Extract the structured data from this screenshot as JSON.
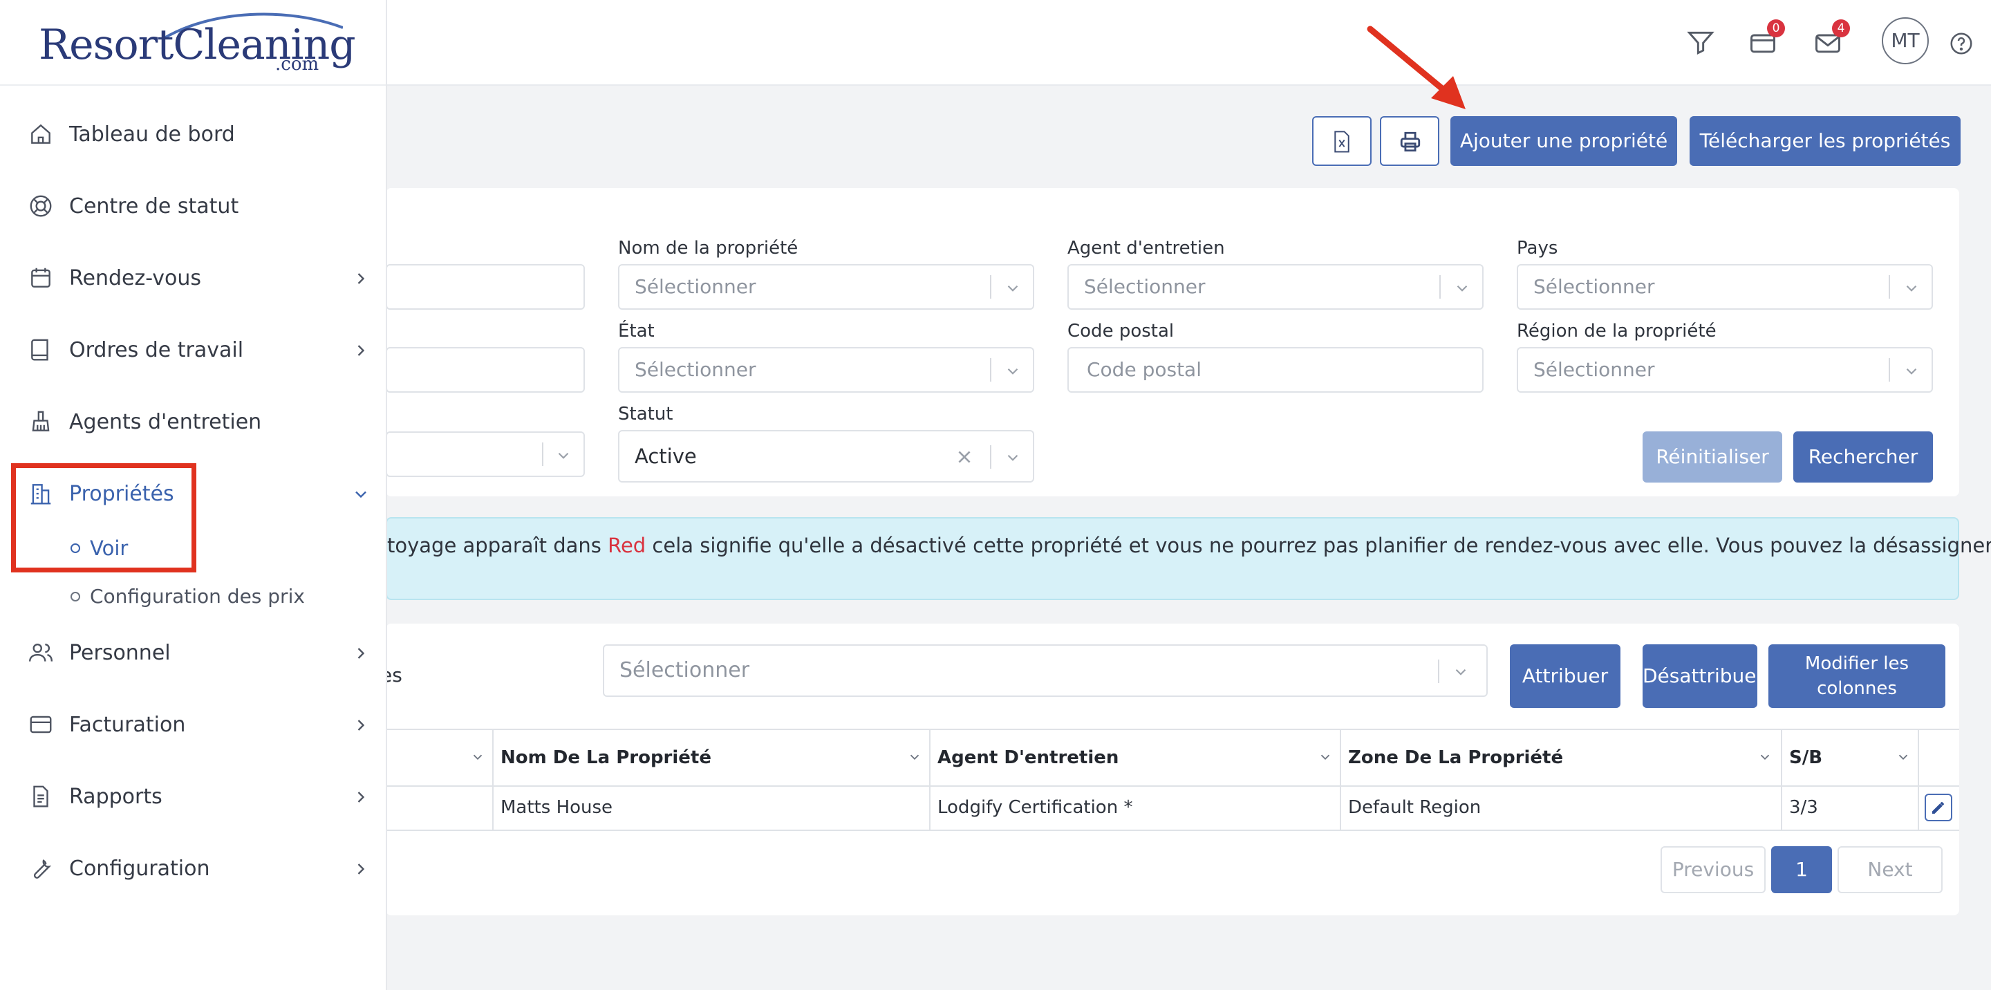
{
  "brand": {
    "logo_main": "ResortCleaning",
    "logo_sub": ".com"
  },
  "header": {
    "cart_badge": "0",
    "mail_badge": "4",
    "avatar_initials": "MT"
  },
  "sidebar": {
    "items": [
      {
        "label": "Tableau de bord",
        "icon": "home-icon"
      },
      {
        "label": "Centre de statut",
        "icon": "lifebuoy-icon"
      },
      {
        "label": "Rendez-vous",
        "icon": "calendar-icon"
      },
      {
        "label": "Ordres de travail",
        "icon": "book-icon"
      },
      {
        "label": "Agents d'entretien",
        "icon": "broom-icon"
      },
      {
        "label": "Propriétés",
        "icon": "building-icon"
      },
      {
        "label": "Personnel",
        "icon": "users-icon"
      },
      {
        "label": "Facturation",
        "icon": "credit-card-icon"
      },
      {
        "label": "Rapports",
        "icon": "document-icon"
      },
      {
        "label": "Configuration",
        "icon": "wrench-icon"
      }
    ],
    "sub_items": [
      {
        "label": "Voir"
      },
      {
        "label": "Configuration des prix"
      }
    ]
  },
  "toolbar": {
    "add_property": "Ajouter une propriété",
    "download_properties": "Télécharger les propriétés"
  },
  "filters": {
    "property_name_label": "Nom de la propriété",
    "property_name_placeholder": "Sélectionner",
    "cleaning_agent_label": "Agent d'entretien",
    "cleaning_agent_placeholder": "Sélectionner",
    "country_label": "Pays",
    "country_placeholder": "Sélectionner",
    "state_label": "État",
    "state_placeholder": "Sélectionner",
    "postal_code_label": "Code postal",
    "postal_code_placeholder": "Code postal",
    "region_label": "Région de la propriété",
    "region_placeholder": "Sélectionner",
    "status_label": "Statut",
    "status_value": "Active",
    "reset_button": "Réinitialiser",
    "search_button": "Rechercher"
  },
  "alert": {
    "text_before": "toyage apparaît dans ",
    "red_word": "Red",
    "text_after": " cela signifie qu'elle a désactivé cette propriété et vous ne pourrez pas planifier de rendez-vous avec elle. Vous pouvez la désassigner de la"
  },
  "assign": {
    "partial_label": "es",
    "select_placeholder": "Sélectionner",
    "assign_button": "Attribuer",
    "unassign_button": "Désattribuer",
    "modify_columns_line1": "Modifier les",
    "modify_columns_line2": "colonnes"
  },
  "table": {
    "columns": [
      "Nom De La Propriété",
      "Agent D'entretien",
      "Zone De La Propriété",
      "S/B"
    ],
    "rows": [
      {
        "name": "Matts House",
        "agent": "Lodgify Certification *",
        "zone": "Default Region",
        "sb": "3/3"
      }
    ]
  },
  "pagination": {
    "previous": "Previous",
    "current": "1",
    "next": "Next"
  },
  "colors": {
    "primary": "#4a6db5",
    "primary_light": "#98b0d8",
    "alert_bg": "#d7f1f8",
    "highlight": "#e0321f",
    "badge": "#d9333f"
  }
}
